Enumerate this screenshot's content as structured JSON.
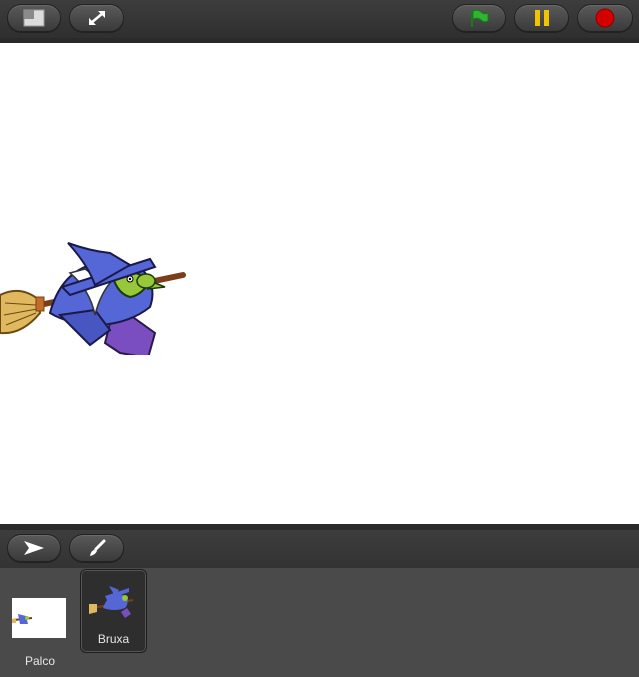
{
  "toolbar": {
    "layout_icon": "small-stage-icon",
    "fullscreen_icon": "fullscreen-icon",
    "green_flag_icon": "green-flag-icon",
    "pause_icon": "pause-icon",
    "stop_icon": "stop-icon",
    "colors": {
      "flag": "#2fb52f",
      "pause": "#f2c400",
      "stop": "#d40000"
    }
  },
  "stage": {
    "sprite_icon": "witch-on-broom"
  },
  "tools": {
    "select_icon": "arrow-pointer-icon",
    "paint_icon": "paintbrush-icon"
  },
  "sprites": {
    "stage_label": "Palco",
    "items": [
      {
        "label": "Bruxa",
        "selected": true
      }
    ]
  }
}
